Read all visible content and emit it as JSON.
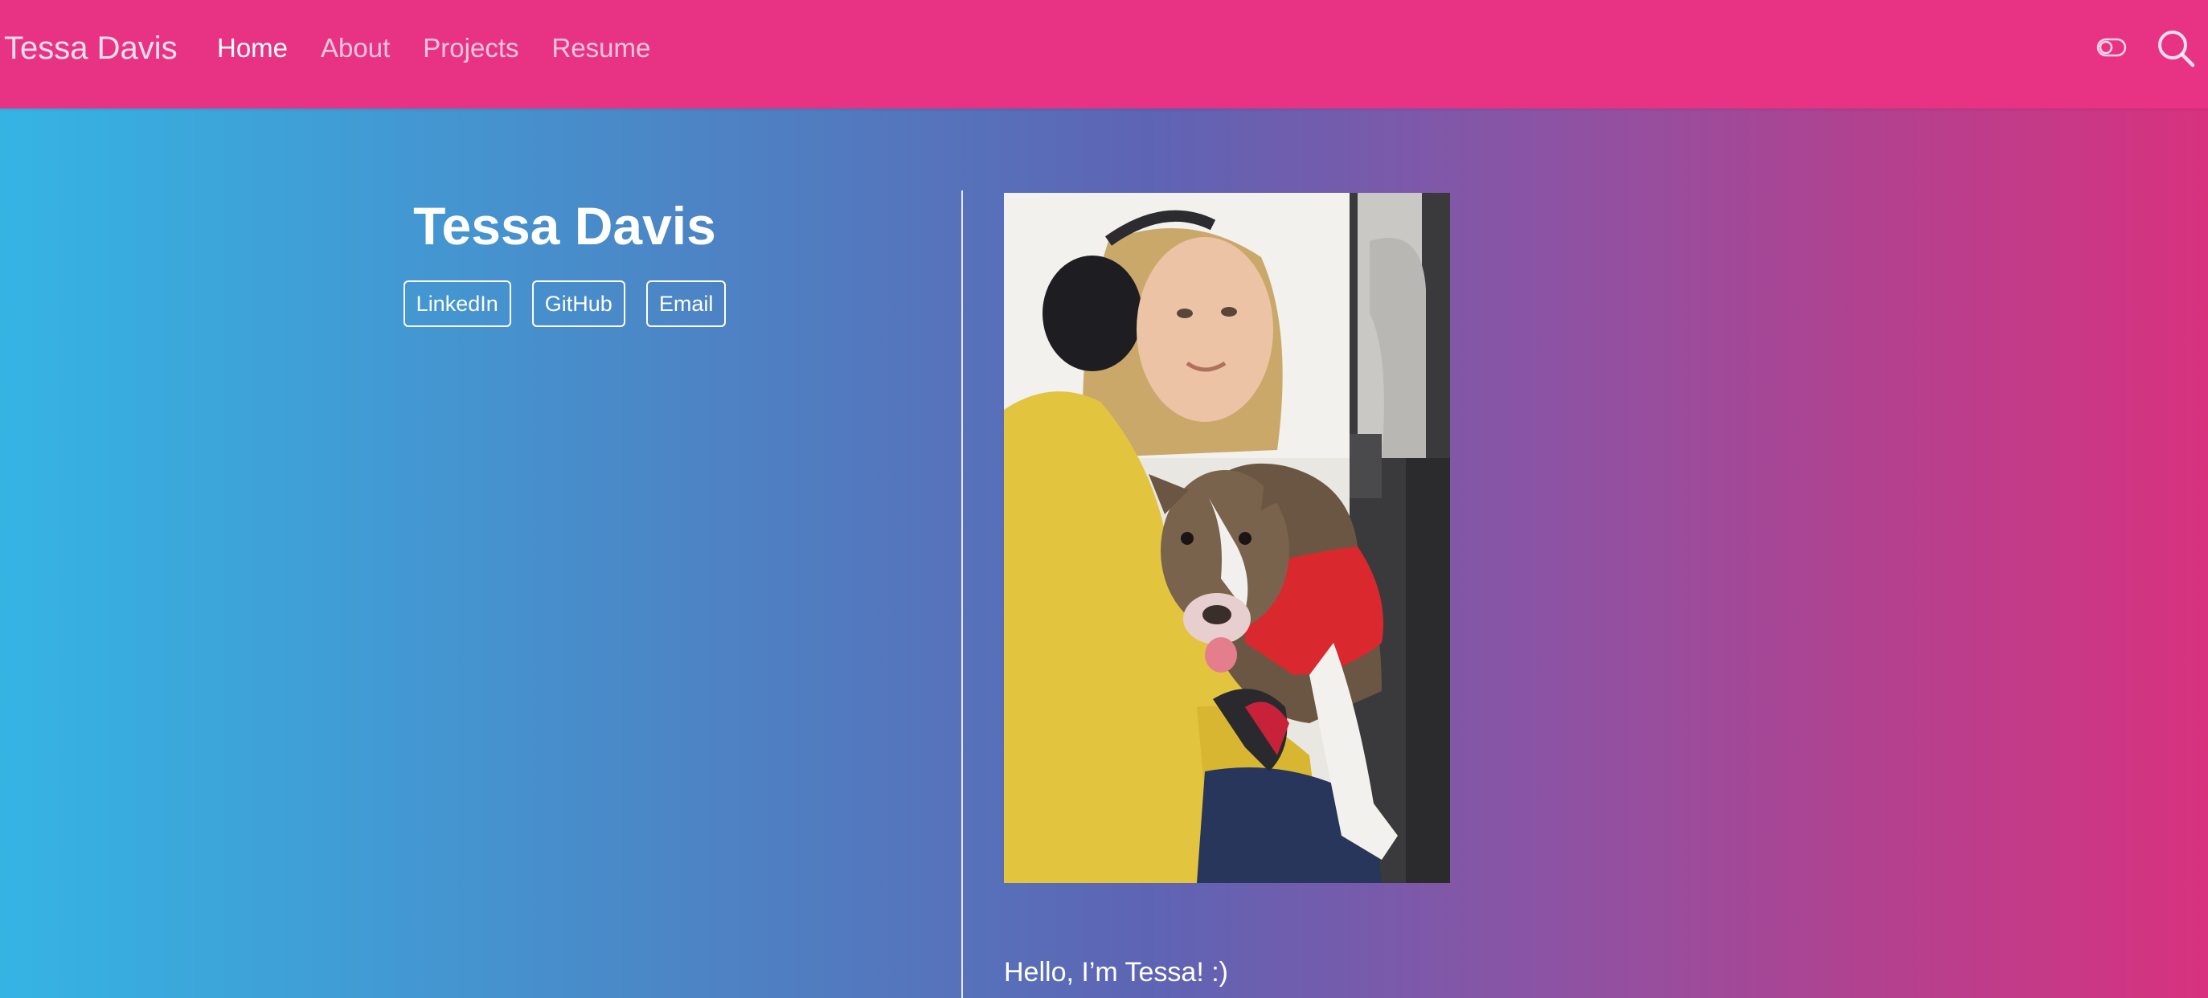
{
  "navbar": {
    "brand": "Tessa Davis",
    "links": [
      {
        "label": "Home",
        "active": true
      },
      {
        "label": "About",
        "active": false
      },
      {
        "label": "Projects",
        "active": false
      },
      {
        "label": "Resume",
        "active": false
      }
    ],
    "icons": [
      "theme-toggle-icon",
      "search-icon"
    ],
    "background_color": "#e83385"
  },
  "hero": {
    "name": "Tessa Davis",
    "links": [
      "LinkedIn",
      "GitHub",
      "Email"
    ]
  },
  "about": {
    "photo_subject": "profile-photo",
    "greeting": "Hello, I’m Tessa! :)"
  },
  "colors": {
    "gradient_left": "#35b4e4",
    "gradient_mid": "#5e64b4",
    "gradient_right": "#d8327f"
  }
}
